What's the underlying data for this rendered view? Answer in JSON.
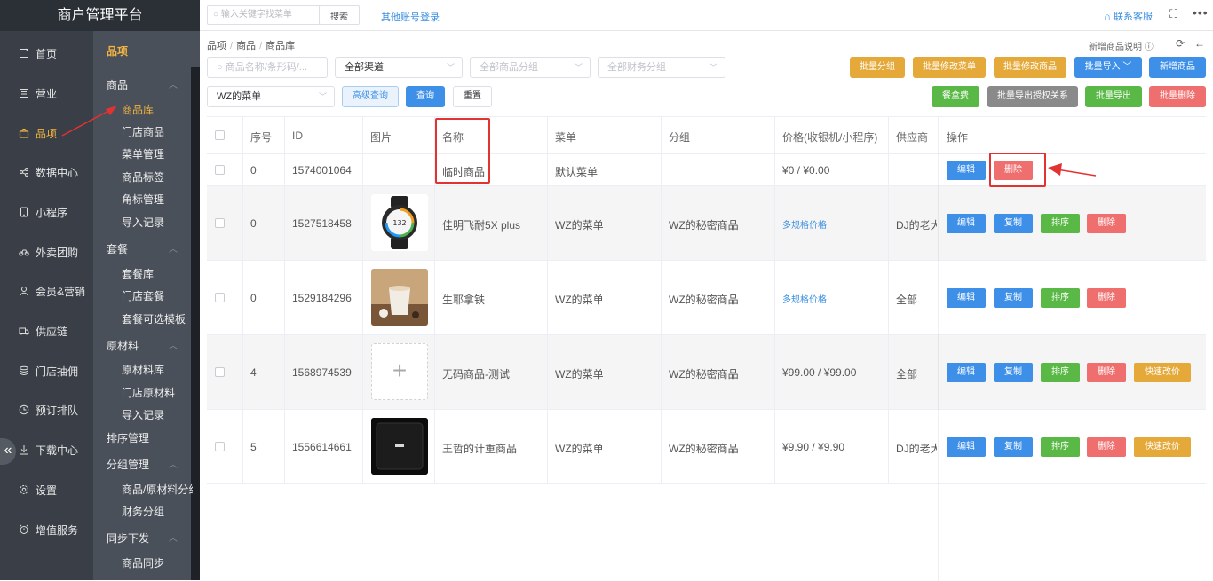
{
  "brand": "商户管理平台",
  "nav": {
    "items": [
      {
        "label": "首页",
        "icon": "home-icon"
      },
      {
        "label": "营业",
        "icon": "register-icon"
      },
      {
        "label": "品项",
        "icon": "bag-icon",
        "active": true
      },
      {
        "label": "数据中心",
        "icon": "share-icon"
      },
      {
        "label": "小程序",
        "icon": "phone-icon"
      },
      {
        "label": "外卖团购",
        "icon": "bike-icon"
      },
      {
        "label": "会员&营销",
        "icon": "user-icon"
      },
      {
        "label": "供应链",
        "icon": "truck-icon"
      },
      {
        "label": "门店抽佣",
        "icon": "database-icon"
      },
      {
        "label": "预订排队",
        "icon": "clock-icon"
      },
      {
        "label": "下载中心",
        "icon": "download-icon"
      },
      {
        "label": "设置",
        "icon": "gear-icon"
      },
      {
        "label": "增值服务",
        "icon": "alarm-icon"
      }
    ],
    "collapse": "«"
  },
  "subnav": {
    "header": "品项",
    "groups": [
      {
        "title": "商品",
        "links": [
          "商品库",
          "门店商品",
          "菜单管理",
          "商品标签",
          "角标管理",
          "导入记录"
        ]
      },
      {
        "title": "套餐",
        "links": [
          "套餐库",
          "门店套餐",
          "套餐可选模板"
        ]
      },
      {
        "title": "原材料",
        "links": [
          "原材料库",
          "门店原材料",
          "导入记录"
        ]
      },
      {
        "title": "排序管理",
        "links": []
      },
      {
        "title": "分组管理",
        "links": [
          "商品/原材料分组",
          "财务分组"
        ]
      },
      {
        "title": "同步下发",
        "links": [
          "商品同步"
        ]
      }
    ],
    "active_link": "商品库"
  },
  "topbar": {
    "search_placeholder": "输入关键字找菜单",
    "search_button": "搜索",
    "other_login": "其他账号登录",
    "contact": "联系客服",
    "more": "•••"
  },
  "breadcrumb": [
    "品项",
    "商品",
    "商品库"
  ],
  "help_text": "新增商品说明",
  "filters": {
    "name_placeholder": "商品名称/条形码/...",
    "channel": "全部渠道",
    "group_placeholder": "全部商品分组",
    "finance_placeholder": "全部财务分组",
    "menu": "WZ的菜单",
    "advanced": "高级查询",
    "query": "查询",
    "reset": "重置"
  },
  "actions_row1": [
    "批量分组",
    "批量修改菜单",
    "批量修改商品",
    "批量导入",
    "新增商品"
  ],
  "actions_row2": [
    "餐盒费",
    "批量导出授权关系",
    "批量导出",
    "批量删除"
  ],
  "table": {
    "headers": [
      "序号",
      "ID",
      "图片",
      "名称",
      "菜单",
      "分组",
      "价格(收银机/小程序)",
      "供应商",
      "操作"
    ],
    "rows": [
      {
        "seq": "0",
        "id": "1574001064",
        "name": "临时商品",
        "menu": "默认菜单",
        "group": "",
        "price": "¥0 / ¥0.00",
        "supplier": "",
        "image": "none",
        "ops": [
          "编辑",
          "删除"
        ]
      },
      {
        "seq": "0",
        "id": "1527518458",
        "name": "佳明飞耐5X plus",
        "menu": "WZ的菜单",
        "group": "WZ的秘密商品",
        "price": "多规格价格",
        "supplier": "DJ的老大",
        "image": "watch",
        "ops": [
          "编辑",
          "复制",
          "排序",
          "删除"
        ]
      },
      {
        "seq": "0",
        "id": "1529184296",
        "name": "生耶拿铁",
        "menu": "WZ的菜单",
        "group": "WZ的秘密商品",
        "price": "多规格价格",
        "supplier": "全部",
        "image": "coffee",
        "ops": [
          "编辑",
          "复制",
          "排序",
          "删除"
        ]
      },
      {
        "seq": "4",
        "id": "1568974539",
        "name": "无码商品-测试",
        "menu": "WZ的菜单",
        "group": "WZ的秘密商品",
        "price": "¥99.00 / ¥99.00",
        "supplier": "全部",
        "image": "placeholder",
        "ops": [
          "编辑",
          "复制",
          "排序",
          "删除",
          "快速改价"
        ]
      },
      {
        "seq": "5",
        "id": "1556614661",
        "name": "王哲的计重商品",
        "menu": "WZ的菜单",
        "group": "WZ的秘密商品",
        "price": "¥9.90 / ¥9.90",
        "supplier": "DJ的老大",
        "image": "tablet",
        "ops": [
          "编辑",
          "复制",
          "排序",
          "删除",
          "快速改价"
        ]
      }
    ]
  },
  "colors": {
    "accent": "#f2b440",
    "primary": "#3d8fe8",
    "danger": "#ef6f6f",
    "success": "#5ab946",
    "warning": "#e5a93a",
    "annotation": "#e23232"
  }
}
